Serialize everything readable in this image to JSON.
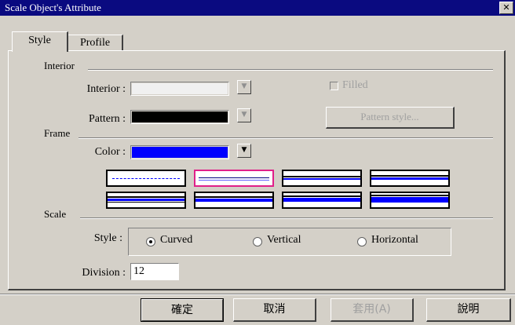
{
  "window": {
    "title": "Scale Object's Attribute",
    "close_glyph": "✕"
  },
  "tabs": [
    {
      "label": "Style",
      "active": true
    },
    {
      "label": "Profile",
      "active": false
    }
  ],
  "interior": {
    "group_label": "Interior",
    "interior_label": "Interior :",
    "interior_color": "#f0f0f0",
    "pattern_label": "Pattern :",
    "pattern_color": "#000000",
    "filled_label": "Filled",
    "filled_checked": false,
    "pattern_style_button": "Pattern style..."
  },
  "frame": {
    "group_label": "Frame",
    "color_label": "Color :",
    "color_value": "#0000ff",
    "line_styles_selected_index": 1
  },
  "scale": {
    "group_label": "Scale",
    "style_label": "Style :",
    "options": [
      "Curved",
      "Vertical",
      "Horizontal"
    ],
    "selected": "Curved",
    "division_label": "Division :",
    "division_value": "12"
  },
  "buttons": {
    "ok": "確定",
    "cancel": "取消",
    "apply": "套用(A)",
    "help": "說明"
  },
  "colors": {
    "titlebar": "#0a0a80",
    "dialog_bg": "#d4d0c8",
    "selection": "#e0208a",
    "line_blue": "#0000ff"
  }
}
